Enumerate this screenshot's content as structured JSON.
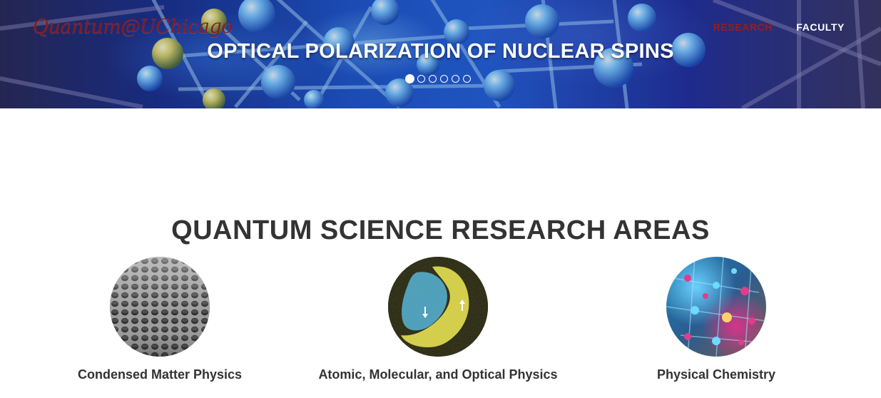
{
  "header": {
    "brand": "Quantum@UChicago",
    "nav": [
      {
        "label": "RESEARCH",
        "active": true
      },
      {
        "label": "FACULTY",
        "active": false
      }
    ]
  },
  "hero": {
    "slide_title": "OPTICAL POLARIZATION OF NUCLEAR SPINS",
    "slide_count": 6,
    "active_slide": 1
  },
  "research": {
    "title": "QUANTUM SCIENCE RESEARCH AREAS",
    "areas": [
      {
        "label": "Condensed Matter Physics",
        "image": "graphene-lattice-image"
      },
      {
        "label": "Atomic, Molecular, and Optical Physics",
        "image": "spin-domains-image"
      },
      {
        "label": "Physical Chemistry",
        "image": "molecular-structure-image"
      }
    ]
  },
  "colors": {
    "brand": "#8b1a1a",
    "nav_active": "#9b1b1b",
    "heading": "#333333"
  }
}
